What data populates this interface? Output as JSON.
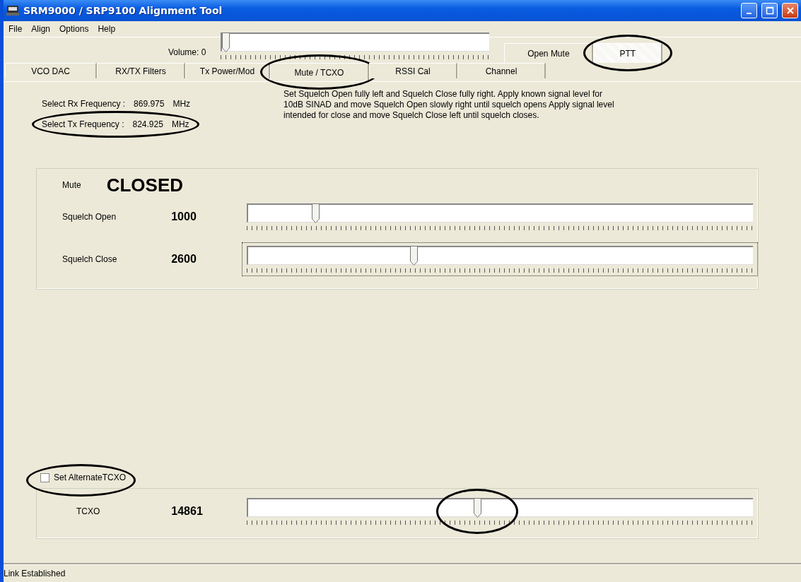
{
  "window": {
    "title": "SRM9000 / SRP9100 Alignment Tool"
  },
  "menu": [
    "File",
    "Align",
    "Options",
    "Help"
  ],
  "toolbar": {
    "volume_label": "Volume: 0",
    "volume": {
      "level": 0
    },
    "buttons": [
      {
        "label": "Open Mute",
        "pressed": false,
        "circled": false
      },
      {
        "label": "PTT",
        "pressed": true,
        "circled": true
      }
    ]
  },
  "tabs": [
    {
      "label": "VCO DAC",
      "selected": false,
      "circled": false
    },
    {
      "label": "RX/TX Filters",
      "selected": false,
      "circled": false
    },
    {
      "label": "Tx Power/Mod",
      "selected": false,
      "circled": false
    },
    {
      "label": "Mute / TCXO",
      "selected": true,
      "circled": true
    },
    {
      "label": "RSSI Cal",
      "selected": false,
      "circled": false
    },
    {
      "label": "Channel",
      "selected": false,
      "circled": false
    }
  ],
  "frequencies": [
    {
      "label": "Select Rx Frequency :",
      "value": "869.975",
      "unit": "MHz",
      "circled": false
    },
    {
      "label": "Select Tx Frequency :",
      "value": "824.925",
      "unit": "MHz",
      "circled": true
    }
  ],
  "instructions": "Set Squelch Open fully left and Squelch Close fully right.  Apply known signal level for 10dB SINAD and move Squelch Open slowly right until squelch opens  Apply signal level intended for close and move Squelch Close left until squelch closes.",
  "mute": {
    "label": "Mute",
    "status": "CLOSED"
  },
  "squelch": [
    {
      "label": "Squelch Open",
      "value": "1000",
      "level": 0.13,
      "focused": false
    },
    {
      "label": "Squelch Close",
      "value": "2600",
      "level": 0.33,
      "focused": true
    }
  ],
  "alternate_tcxo": {
    "label": "Set AlternateTCXO",
    "checked": false,
    "circled": true
  },
  "tcxo": {
    "label": "TCXO",
    "value": "14861",
    "level": 0.46,
    "circled": true
  },
  "status_bar": "Link Established"
}
